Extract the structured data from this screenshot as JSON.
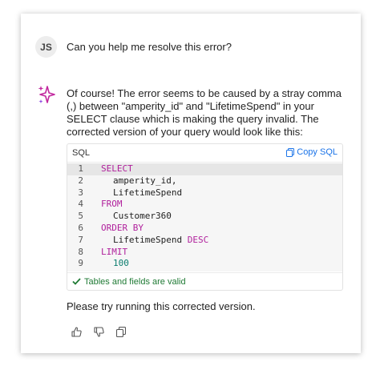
{
  "user": {
    "initials": "JS",
    "message": "Can you help me resolve this error?"
  },
  "assistant": {
    "message": "Of course! The error seems to be caused by a stray comma (,) between \"amperity_id\" and \"LifetimeSpend\" in your SELECT clause which is making the query invalid. The corrected version of your query would look like this:",
    "closing": "Please try running this corrected version."
  },
  "code_block": {
    "language": "SQL",
    "copy_label": "Copy SQL",
    "lines": [
      {
        "num": "1",
        "text": "SELECT"
      },
      {
        "num": "2",
        "text": "amperity_id,"
      },
      {
        "num": "3",
        "text": "LifetimeSpend"
      },
      {
        "num": "4",
        "text": "FROM"
      },
      {
        "num": "5",
        "text": "Customer360"
      },
      {
        "num": "6",
        "text": "ORDER BY"
      },
      {
        "num": "7",
        "text": "LifetimeSpend",
        "suffix": "DESC"
      },
      {
        "num": "8",
        "text": "LIMIT"
      },
      {
        "num": "9",
        "text": "100"
      }
    ],
    "validation": "Tables and fields are valid"
  },
  "icons": {
    "assistant": "sparkle-icon",
    "copy": "copy-icon",
    "valid": "check-icon",
    "thumbs_up": "thumbs-up-icon",
    "thumbs_down": "thumbs-down-icon",
    "copy_response": "copy-icon"
  },
  "colors": {
    "keyword": "#b0209c",
    "number": "#097c6d",
    "link": "#1a73e8",
    "valid": "#1f7a34",
    "sparkle": "#c2279e"
  }
}
